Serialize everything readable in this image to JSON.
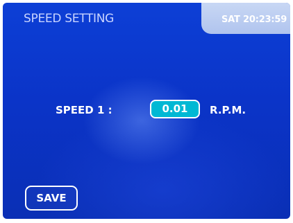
{
  "header": {
    "title": "SPEED SETTING",
    "clock": "SAT 20:23:59"
  },
  "main": {
    "speed_label": "SPEED 1 :",
    "speed_value": "0.01",
    "speed_unit": "R.P.M."
  },
  "footer": {
    "save_label": "SAVE"
  },
  "colors": {
    "background": "#0b38cc",
    "clock_tab": "#b8cbf0",
    "value_field": "#00b8d4",
    "text": "#ffffff"
  }
}
